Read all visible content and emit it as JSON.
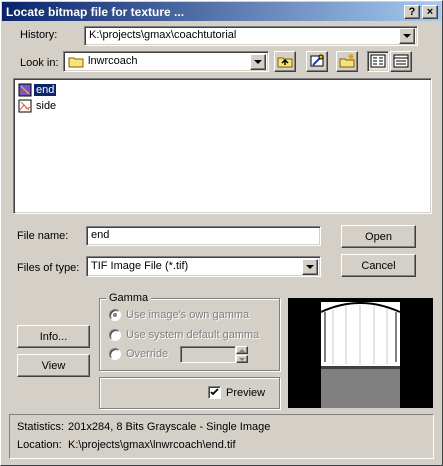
{
  "window": {
    "title": "Locate bitmap file for texture ...",
    "help_button": "?",
    "close_button": "×"
  },
  "history": {
    "label": "History:",
    "value": "K:\\projects\\gmax\\coachtutorial"
  },
  "look_in": {
    "label": "Look in:",
    "value": "lnwrcoach"
  },
  "toolbar": {
    "up_one_level_icon": "folder-up-icon",
    "find_icon": "search-folder-icon",
    "new_folder_icon": "new-folder-icon",
    "list_view_icon": "list-view-icon",
    "details_view_icon": "details-view-icon"
  },
  "files": [
    {
      "name": "end",
      "icon": "image-file-icon",
      "selected": true
    },
    {
      "name": "side",
      "icon": "image-file-icon",
      "selected": false
    }
  ],
  "file_name": {
    "label": "File name:",
    "value": "end"
  },
  "file_type": {
    "label": "Files of type:",
    "value": "TIF Image File (*.tif)"
  },
  "buttons": {
    "open": "Open",
    "cancel": "Cancel",
    "info": "Info...",
    "view": "View"
  },
  "gamma": {
    "title": "Gamma",
    "options": [
      {
        "label": "Use image's own gamma",
        "checked": true
      },
      {
        "label": "Use system default gamma",
        "checked": false
      },
      {
        "label": "Override",
        "checked": false
      }
    ],
    "override_value": ""
  },
  "preview": {
    "label": "Preview",
    "checked": true
  },
  "status": {
    "statistics_label": "Statistics:",
    "statistics_value": "201x284, 8 Bits Grayscale - Single Image",
    "location_label": "Location:",
    "location_value": "K:\\projects\\gmax\\lnwrcoach\\end.tif"
  },
  "colors": {
    "face": "#d4d0c8",
    "title_start": "#0a246a",
    "title_end": "#a6caf0",
    "selection": "#0a246a"
  }
}
